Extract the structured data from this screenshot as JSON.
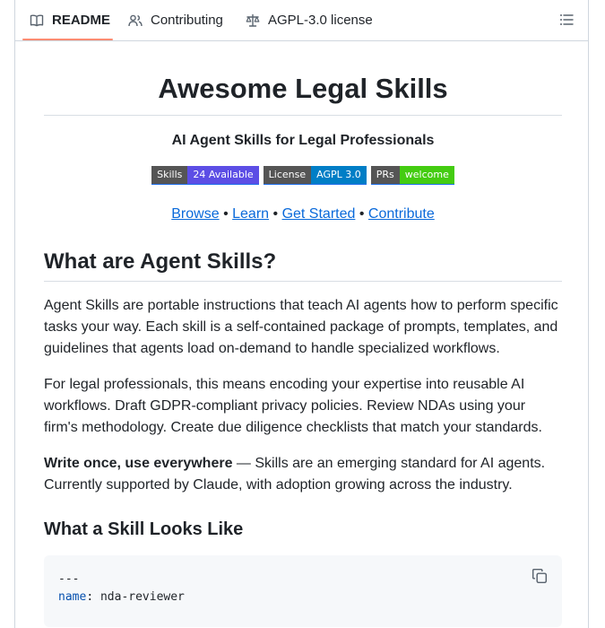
{
  "tabs": [
    {
      "label": "README",
      "icon": "book-icon",
      "active": true
    },
    {
      "label": "Contributing",
      "icon": "people-icon"
    },
    {
      "label": "AGPL-3.0 license",
      "icon": "law-icon"
    }
  ],
  "outline_icon": "list-unordered-icon",
  "readme": {
    "title": "Awesome Legal Skills",
    "subtitle": "AI Agent Skills for Legal Professionals",
    "badges": [
      {
        "label": "Skills",
        "value": "24 Available",
        "color": "#5c4ee5"
      },
      {
        "label": "License",
        "value": "AGPL 3.0",
        "color": "#007ec6"
      },
      {
        "label": "PRs",
        "value": "welcome",
        "color": "#4c1"
      }
    ],
    "links": [
      "Browse",
      "Learn",
      "Get Started",
      "Contribute"
    ],
    "link_separator": "•",
    "section_heading": "What are Agent Skills?",
    "para1": "Agent Skills are portable instructions that teach AI agents how to perform specific tasks your way. Each skill is a self-contained package of prompts, templates, and guidelines that agents load on-demand to handle specialized workflows.",
    "para2": "For legal professionals, this means encoding your expertise into reusable AI workflows. Draft GDPR-compliant privacy policies. Review NDAs using your firm's methodology. Create due diligence checklists that match your standards.",
    "para3_bold": "Write once, use everywhere",
    "para3_rest": " — Skills are an emerging standard for AI agents. Currently supported by Claude, with adoption growing across the industry.",
    "subheading": "What a Skill Looks Like",
    "code": {
      "line1": "---",
      "line2_key": "name",
      "line2_rest": ": nda-reviewer"
    }
  },
  "colors": {
    "tab_accent": "#fd8c73",
    "link": "#0969da",
    "code_key": "#0550ae"
  }
}
